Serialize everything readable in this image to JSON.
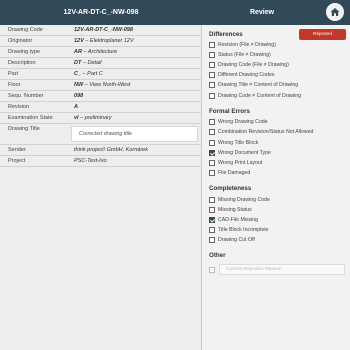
{
  "header": {
    "document_title": "12V-AR-DT-C_-NW-098",
    "review_title": "Review",
    "home_icon": "home-icon"
  },
  "details": [
    {
      "label": "Drawing Code",
      "value": "12V-AR-DT-C_-NW-098"
    },
    {
      "label": "Originator",
      "code": "12V",
      "desc": "Elektroplaner 12V"
    },
    {
      "label": "Drawing type",
      "code": "AR",
      "desc": "Architecture"
    },
    {
      "label": "Description",
      "code": "DT",
      "desc": "Detail"
    },
    {
      "label": "Part",
      "code": "C_",
      "desc": "Part C"
    },
    {
      "label": "Floor",
      "code": "NW",
      "desc": "View North-West"
    },
    {
      "label": "Sequ. Number",
      "value": "098"
    },
    {
      "label": "Revision",
      "value": "A"
    },
    {
      "label": "Examination State",
      "code": "vl",
      "desc": "preliminary"
    },
    {
      "label": "Drawing Title",
      "input_value": "Corrected drawing title"
    },
    {
      "label": "Sender",
      "value": "think project! GmbH, Kornárek"
    },
    {
      "label": "Project",
      "value": "PSC-Test-Ivo"
    }
  ],
  "review": {
    "status_badge": "Rejected",
    "status_color": "#c0392b",
    "sections": [
      {
        "title": "Differences",
        "items": [
          {
            "label": "Revision (File ≠ Drawing)",
            "checked": false
          },
          {
            "label": "Status (File ≠ Drawing)",
            "checked": false
          },
          {
            "label": "Drawing Code (File ≠ Drawing)",
            "checked": false
          },
          {
            "label": "Different Drawing Codes",
            "checked": false
          },
          {
            "label": "Drawing Title ≠ Content of Drawing",
            "checked": false
          },
          {
            "label": "Drawing Code ≠ Content of Drawing",
            "checked": false
          }
        ]
      },
      {
        "title": "Formal Errors",
        "items": [
          {
            "label": "Wrong Drawing Code",
            "checked": false
          },
          {
            "label": "Combination Revision/Status Not Allowed",
            "checked": false
          },
          {
            "label": "Wrong Title Block",
            "checked": false
          },
          {
            "label": "Wrong Document Type",
            "checked": true
          },
          {
            "label": "Wrong Print Layout",
            "checked": false
          },
          {
            "label": "File Damaged",
            "checked": false
          }
        ]
      },
      {
        "title": "Completeness",
        "items": [
          {
            "label": "Missing Drawing Code",
            "checked": false
          },
          {
            "label": "Missing Status",
            "checked": false
          },
          {
            "label": "CAD-File Missing",
            "checked": true
          },
          {
            "label": "Title Block Incomplete",
            "checked": false
          },
          {
            "label": "Drawing Cut Off",
            "checked": false
          }
        ]
      },
      {
        "title": "Other",
        "items": []
      }
    ],
    "custom_reason_placeholder": "Custom Rejection Reason"
  },
  "colors": {
    "header": "#324a58",
    "checkbox_checked": "#3a4a56"
  }
}
